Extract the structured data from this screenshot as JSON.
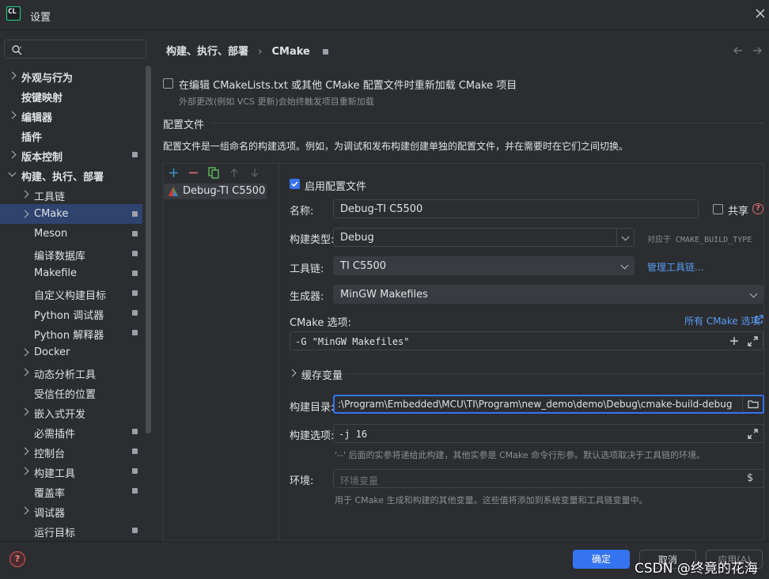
{
  "window": {
    "app_icon": "CL",
    "title": "设置"
  },
  "search": {
    "placeholder": ""
  },
  "breadcrumb": {
    "parent": "构建、执行、部署",
    "separator": "›",
    "current": "CMake"
  },
  "sidebar": {
    "items": [
      {
        "label": "外观与行为",
        "expand": "right",
        "level": 0,
        "bold": true,
        "lock": false,
        "selected": false
      },
      {
        "label": "按键映射",
        "expand": "none",
        "level": 0,
        "bold": true,
        "lock": false,
        "selected": false
      },
      {
        "label": "编辑器",
        "expand": "right",
        "level": 0,
        "bold": true,
        "lock": false,
        "selected": false
      },
      {
        "label": "插件",
        "expand": "none",
        "level": 0,
        "bold": true,
        "lock": false,
        "selected": false
      },
      {
        "label": "版本控制",
        "expand": "right",
        "level": 0,
        "bold": true,
        "lock": true,
        "selected": false
      },
      {
        "label": "构建、执行、部署",
        "expand": "down",
        "level": 0,
        "bold": true,
        "lock": false,
        "selected": false
      },
      {
        "label": "工具链",
        "expand": "right",
        "level": 1,
        "bold": false,
        "lock": false,
        "selected": false
      },
      {
        "label": "CMake",
        "expand": "right",
        "level": 1,
        "bold": false,
        "lock": true,
        "selected": true
      },
      {
        "label": "Meson",
        "expand": "none",
        "level": 1,
        "bold": false,
        "lock": true,
        "selected": false
      },
      {
        "label": "编译数据库",
        "expand": "none",
        "level": 1,
        "bold": false,
        "lock": true,
        "selected": false
      },
      {
        "label": "Makefile",
        "expand": "none",
        "level": 1,
        "bold": false,
        "lock": true,
        "selected": false
      },
      {
        "label": "自定义构建目标",
        "expand": "none",
        "level": 1,
        "bold": false,
        "lock": true,
        "selected": false
      },
      {
        "label": "Python 调试器",
        "expand": "none",
        "level": 1,
        "bold": false,
        "lock": true,
        "selected": false
      },
      {
        "label": "Python 解释器",
        "expand": "none",
        "level": 1,
        "bold": false,
        "lock": true,
        "selected": false
      },
      {
        "label": "Docker",
        "expand": "right",
        "level": 1,
        "bold": false,
        "lock": false,
        "selected": false
      },
      {
        "label": "动态分析工具",
        "expand": "right",
        "level": 1,
        "bold": false,
        "lock": false,
        "selected": false
      },
      {
        "label": "受信任的位置",
        "expand": "none",
        "level": 1,
        "bold": false,
        "lock": false,
        "selected": false
      },
      {
        "label": "嵌入式开发",
        "expand": "right",
        "level": 1,
        "bold": false,
        "lock": false,
        "selected": false
      },
      {
        "label": "必需插件",
        "expand": "none",
        "level": 1,
        "bold": false,
        "lock": true,
        "selected": false
      },
      {
        "label": "控制台",
        "expand": "right",
        "level": 1,
        "bold": false,
        "lock": true,
        "selected": false
      },
      {
        "label": "构建工具",
        "expand": "right",
        "level": 1,
        "bold": false,
        "lock": true,
        "selected": false
      },
      {
        "label": "覆盖率",
        "expand": "none",
        "level": 1,
        "bold": false,
        "lock": true,
        "selected": false
      },
      {
        "label": "调试器",
        "expand": "right",
        "level": 1,
        "bold": false,
        "lock": false,
        "selected": false
      },
      {
        "label": "运行目标",
        "expand": "none",
        "level": 1,
        "bold": false,
        "lock": true,
        "selected": false
      }
    ]
  },
  "reload": {
    "label": "在编辑 CMakeLists.txt 或其他 CMake 配置文件时重新加载 CMake 项目",
    "hint": "外部更改(例如 VCS 更新)会始终触发项目重新加载",
    "checked": false
  },
  "profiles": {
    "section_title": "配置文件",
    "description": "配置文件是一组命名的构建选项。例如，为调试和发布构建创建单独的配置文件，并在需要时在它们之间切换。",
    "list": [
      {
        "name": "Debug-TI C5500"
      }
    ]
  },
  "form": {
    "enable_label": "启用配置文件",
    "enable_checked": true,
    "name_label": "名称:",
    "name_value": "Debug-TI C5500",
    "share_label": "共享",
    "build_type_label": "构建类型:",
    "build_type_value": "Debug",
    "build_type_hint": "对应于 CMAKE_BUILD_TYPE",
    "toolchain_label": "工具链:",
    "toolchain_value": "TI C5500",
    "manage_toolchains_link": "管理工具链...",
    "generator_label": "生成器:",
    "generator_value": "MinGW Makefiles",
    "cmake_options_label": "CMake 选项:",
    "all_cmake_options_link": "所有 CMake 选项",
    "cmake_options_value": "-G \"MinGW Makefiles\"",
    "cache_vars_label": "缓存变量",
    "build_dir_label": "构建目录:",
    "build_dir_value": ":\\Program\\Embedded\\MCU\\TI\\Program\\new_demo\\demo\\Debug\\cmake-build-debug",
    "build_options_label": "构建选项:",
    "build_options_value": "-j 16",
    "build_options_hint": "'--' 后面的实参将递给此构建，其他实参是 CMake 命令行形参。默认选项取决于工具链的环境。",
    "env_label": "环境:",
    "env_placeholder": "环境变量",
    "env_hint": "用于 CMake 生成和构建的其他变量。这些值将添加到系统变量和工具链变量中。"
  },
  "footer": {
    "ok_label": "确定",
    "cancel_label": "取消",
    "apply_label": "应用(A)",
    "watermark": "CSDN @终竟的花海"
  },
  "colors": {
    "accent": "#3574f0",
    "selection": "#2e436e",
    "link": "#589df6",
    "background": "#2b2d30"
  }
}
